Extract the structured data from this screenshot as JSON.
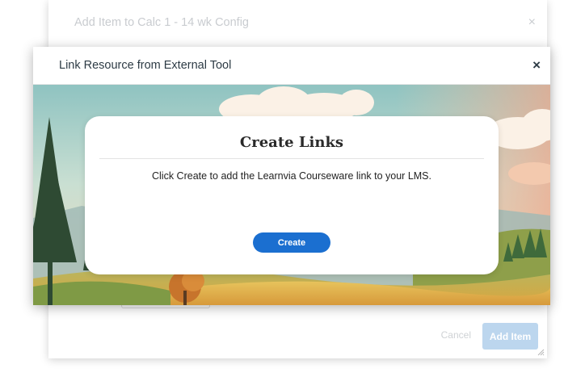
{
  "outer_dialog": {
    "title": "Add Item to Calc 1 - 14 wk Config",
    "close_glyph": "×",
    "cancel_label": "Cancel",
    "add_item_label": "Add Item"
  },
  "link_dialog": {
    "title": "Link Resource from External Tool",
    "close_glyph": "×",
    "card": {
      "title": "Create Links",
      "message": "Click Create to add the Learnvia Courseware link to your LMS.",
      "create_label": "Create"
    }
  },
  "colors": {
    "primary_button": "#1b6fd0",
    "disabled_button": "#bcd6ee",
    "text_dark": "#2d3b45"
  },
  "icons": {
    "close": "close-icon",
    "resize": "resize-handle-icon",
    "chevron": "chevron-down-icon"
  }
}
